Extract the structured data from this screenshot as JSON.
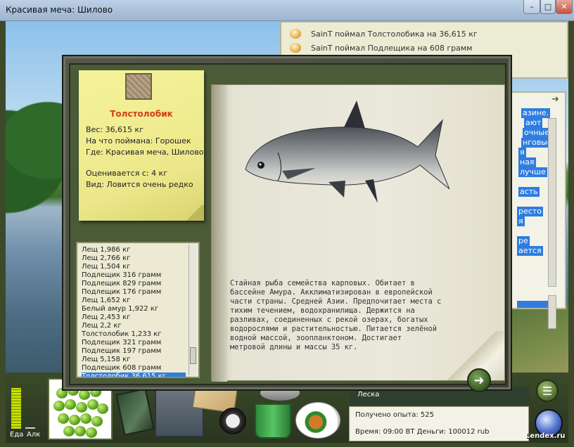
{
  "window": {
    "title": "Красивая меча: Шилово",
    "min_glyph": "–",
    "max_glyph": "□",
    "close_glyph": "✕"
  },
  "chat": {
    "messages": [
      "SainT поймал Толстолобика на 36,615 кг",
      "SainT поймал Подлещика на 608 грамм"
    ],
    "side_fragments": [
      "азине.",
      "ают",
      "очные,",
      "нговые.",
      "я",
      "ная",
      "лучше",
      "асть",
      "ресто",
      "я",
      "ре",
      "ается"
    ]
  },
  "fish_card": {
    "name": "Толстолобик",
    "weight": "Вес: 36,615 кг",
    "bait": "На что поймана: Горошек",
    "place": "Где: Красивая меча, Шилово",
    "price": "Оценивается с: 4 кг",
    "rarity": "Вид: Ловится очень редко"
  },
  "catch_list": {
    "items": [
      "Лещ 1,986 кг",
      "Лещ 2,766 кг",
      "Лещ 1,504 кг",
      "Подлещик 316 грамм",
      "Подлещик 829 грамм",
      "Подлещик 176 грамм",
      "Лещ 1,652 кг",
      "Белый амур 1,922 кг",
      "Лещ 2,453 кг",
      "Лещ 2,2 кг",
      "Толстолобик 1,233 кг",
      "Подлещик 321 грамм",
      "Подлещик 197 грамм",
      "Лещ 5,158 кг",
      "Подлещик 608 грамм",
      "Толстолобик 36,615 кг"
    ],
    "selected_index": 15
  },
  "book": {
    "description": "Стайная рыба семейства карповых. Обитает в\nбассейне Амура. Акклиматизирован в европейской\nчасти страны. Средней Азии. Предпочитает места с\nтихим течением, водохранилища. Держится на\nразливах, соединенных с рекой озерах, богатых\nводорослями и растительностью. Питается зелёной\nводной массой, зоопланктоном. Достигает\nметровой длины и массы 35 кг.",
    "next_glyph": "➜"
  },
  "hud": {
    "food_label": "Еда",
    "alcohol_label": "Алк",
    "food_level": 0.85,
    "alcohol_level": 0.0,
    "line_label": "Леска",
    "experience": "Получено опыта: 525",
    "time_money": "Время: 09:00 ВТ   Деньги:    100012 rub",
    "menu_glyph": "☰"
  },
  "watermark": "Lendex.ru",
  "colors": {
    "accent_selected": "#2f7de0",
    "fish_name": "#d63c14",
    "note_paper": "#f2ef94"
  },
  "icons": [
    "stamp-icon",
    "bait-peas-icon",
    "tackle-box-icon",
    "compass-icon",
    "bucket-icon",
    "food-plate-icon",
    "globe-icon",
    "menu-icon",
    "next-arrow-icon",
    "chat-bulb-icon"
  ]
}
